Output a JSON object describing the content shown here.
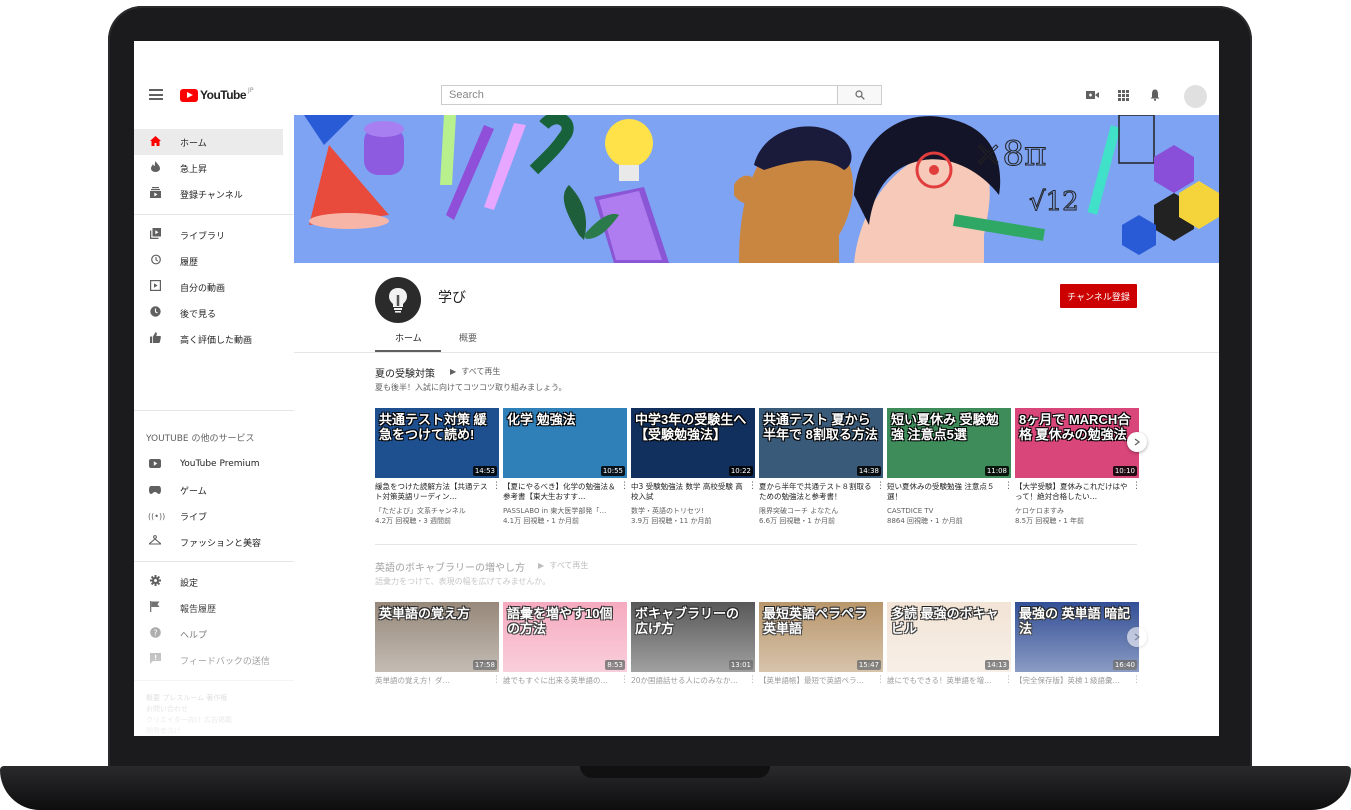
{
  "header": {
    "logo_text": "YouTube",
    "logo_region": "JP",
    "search_placeholder": "Search"
  },
  "sidebar": {
    "main_items": [
      {
        "label": "ホーム",
        "icon": "home-icon"
      },
      {
        "label": "急上昇",
        "icon": "trending-icon"
      },
      {
        "label": "登録チャンネル",
        "icon": "subscriptions-icon"
      }
    ],
    "library_items": [
      {
        "label": "ライブラリ",
        "icon": "library-icon"
      },
      {
        "label": "履歴",
        "icon": "history-icon"
      },
      {
        "label": "自分の動画",
        "icon": "your-videos-icon"
      },
      {
        "label": "後で見る",
        "icon": "watch-later-icon"
      },
      {
        "label": "高く評価した動画",
        "icon": "liked-icon"
      }
    ],
    "services_heading": "YOUTUBE の他のサービス",
    "service_items": [
      {
        "label": "YouTube Premium",
        "icon": "youtube-premium-icon"
      },
      {
        "label": "ゲーム",
        "icon": "gaming-icon"
      },
      {
        "label": "ライブ",
        "icon": "live-icon"
      },
      {
        "label": "ファッションと美容",
        "icon": "fashion-icon"
      }
    ],
    "settings_items": [
      {
        "label": "設定",
        "icon": "settings-icon"
      },
      {
        "label": "報告履歴",
        "icon": "flag-icon"
      },
      {
        "label": "ヘルプ",
        "icon": "help-icon"
      },
      {
        "label": "フィードバックの送信",
        "icon": "feedback-icon"
      }
    ],
    "footer_line1": "概要 プレスルーム 著作権",
    "footer_line2": "お問い合わせ",
    "footer_line3": "クリエイター向け 広告掲載",
    "footer_line4": "開発者向け"
  },
  "channel": {
    "name": "学び",
    "subscribe_label": "チャンネル登録",
    "tabs": [
      "ホーム",
      "概要"
    ]
  },
  "shelves": [
    {
      "title": "夏の受験対策",
      "play_all": "すべて再生",
      "description": "夏も後半！入試に向けてコツコツ取り組みましょう。",
      "videos": [
        {
          "thumb_text": "共通テスト対策 緩急をつけて読め!",
          "duration": "14:53",
          "title": "緩急をつけた読解方法【共通テスト対策英語リーディン…",
          "channel": "「ただよび」文系チャンネル",
          "stats": "4.2万 回視聴・3 週間前",
          "bg": "#1e4f8f"
        },
        {
          "thumb_text": "化学 勉強法",
          "duration": "10:55",
          "title": "【夏にやるべき】化学の勉強法＆参考書【東大生おすす…",
          "channel": "PASSLABO in 東大医学部発「…",
          "stats": "4.1万 回視聴・1 か月前",
          "bg": "#2f7fb8"
        },
        {
          "thumb_text": "中学3年の受験生へ【受験勉強法】",
          "duration": "10:22",
          "title": "中3 受験勉強法 数学 高校受験 高校入試",
          "channel": "数学・英語のトリセツ!",
          "stats": "3.9万 回視聴・11 か月前",
          "bg": "#12305e"
        },
        {
          "thumb_text": "共通テスト 夏から半年で 8割取る方法",
          "duration": "14:38",
          "title": "夏から半年で共通テスト８割取るための勉強法と参考書！",
          "channel": "限界突破コーチ よなたん",
          "stats": "6.6万 回視聴・1 か月前",
          "bg": "#3a5a7a"
        },
        {
          "thumb_text": "短い夏休み 受験勉強 注意点5選",
          "duration": "11:08",
          "title": "短い夏休みの受験勉強 注意点５選！",
          "channel": "CASTDICE TV",
          "stats": "8864 回視聴・1 か月前",
          "bg": "#3d8c5a"
        },
        {
          "thumb_text": "8ヶ月で MARCH合格 夏休みの勉強法",
          "duration": "10:10",
          "title": "【大学受験】夏休みこれだけはやって！絶対合格したい…",
          "channel": "ケロケロますみ",
          "stats": "8.5万 回視聴・1 年前",
          "bg": "#d9467a"
        }
      ]
    },
    {
      "title": "英語のボキャブラリーの増やし方",
      "play_all": "すべて再生",
      "description": "語彙力をつけて、表現の幅を広げてみませんか。",
      "videos": [
        {
          "thumb_text": "英単語の覚え方",
          "duration": "17:58",
          "title": "英単語の覚え方！ダ…",
          "bg": "#8a7a6a"
        },
        {
          "thumb_text": "語彙を増やす10個の方法",
          "duration": "8:53",
          "title": "誰でもすぐに出来る英単語の…",
          "bg": "#f4a0b8"
        },
        {
          "thumb_text": "ボキャブラリーの 広げ方",
          "duration": "13:01",
          "title": "20か国語話せる人にのみなか…",
          "bg": "#444444"
        },
        {
          "thumb_text": "最短英語ペラペラ 英単語",
          "duration": "15:47",
          "title": "【英単語帳】最短で英語ペラ…",
          "bg": "#b08a5a"
        },
        {
          "thumb_text": "多読 最強のボキャビル",
          "duration": "14:13",
          "title": "誰にでもできる！英単語を増…",
          "bg": "#f0e0d0"
        },
        {
          "thumb_text": "最強の 英単語 暗記法",
          "duration": "16:40",
          "title": "【完全保存版】英検１級語彙…",
          "bg": "#1a3a8a"
        }
      ]
    }
  ],
  "colors": {
    "accent_red": "#cc0000",
    "banner_blue": "#7ea3f2"
  }
}
